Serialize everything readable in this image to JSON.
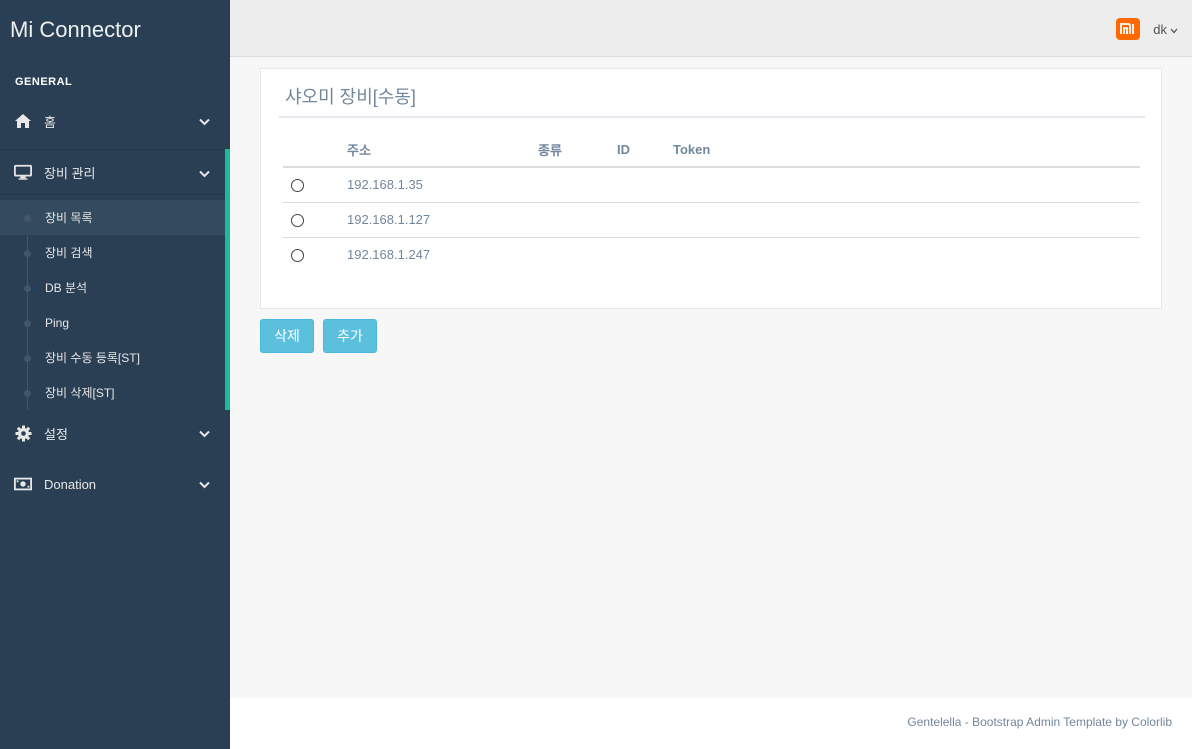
{
  "app": {
    "brand": "Mi Connector"
  },
  "sidebar": {
    "section": "GENERAL",
    "items": [
      {
        "label": "홈",
        "icon": "home-icon"
      },
      {
        "label": "장비 관리",
        "icon": "desktop-icon"
      },
      {
        "label": "설정",
        "icon": "gear-icon"
      },
      {
        "label": "Donation",
        "icon": "money-icon"
      }
    ],
    "submenu": [
      {
        "label": "장비 목록"
      },
      {
        "label": "장비 검색"
      },
      {
        "label": "DB 분석"
      },
      {
        "label": "Ping"
      },
      {
        "label": "장비 수동 등록[ST]"
      },
      {
        "label": "장비 삭제[ST]"
      }
    ]
  },
  "topnav": {
    "user": "dk",
    "logo_text": "mi"
  },
  "panel": {
    "title": "샤오미 장비[수동]",
    "columns": [
      "주소",
      "종류",
      "ID",
      "Token"
    ],
    "rows": [
      {
        "address": "192.168.1.35",
        "type": "",
        "id": "",
        "token": ""
      },
      {
        "address": "192.168.1.127",
        "type": "",
        "id": "",
        "token": ""
      },
      {
        "address": "192.168.1.247",
        "type": "",
        "id": "",
        "token": ""
      }
    ]
  },
  "actions": {
    "delete": "삭제",
    "add": "추가"
  },
  "footer": {
    "text": "Gentelella - Bootstrap Admin Template by Colorlib"
  },
  "colors": {
    "sidebar": "#2A3F54",
    "accent": "#1ABB9C",
    "button": "#5BC0DE",
    "mi_orange": "#FF6900"
  }
}
